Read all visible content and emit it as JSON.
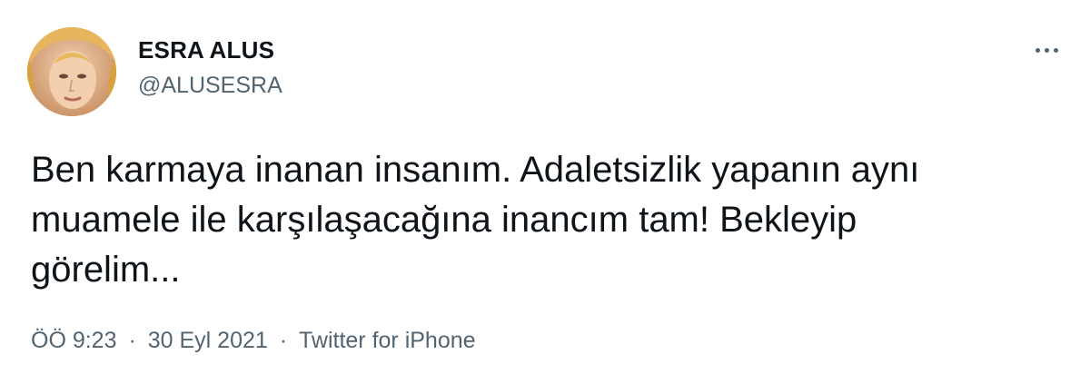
{
  "user": {
    "display_name": "ESRA ALUS",
    "handle": "@ALUSESRA",
    "avatar_icon": "profile-photo"
  },
  "more_icon": "more-horizontal-icon",
  "tweet": {
    "lines": [
      "Ben karmaya inanan insanım. Adaletsizlik yapanın aynı",
      "muamele ile karşılaşacağına inancım tam! Bekleyip",
      "görelim..."
    ]
  },
  "meta": {
    "time": "ÖÖ 9:23",
    "separator": "·",
    "date": "30 Eyl 2021",
    "source": "Twitter for iPhone"
  },
  "colors": {
    "text": "#0f1419",
    "secondary": "#536471",
    "background": "#ffffff"
  }
}
